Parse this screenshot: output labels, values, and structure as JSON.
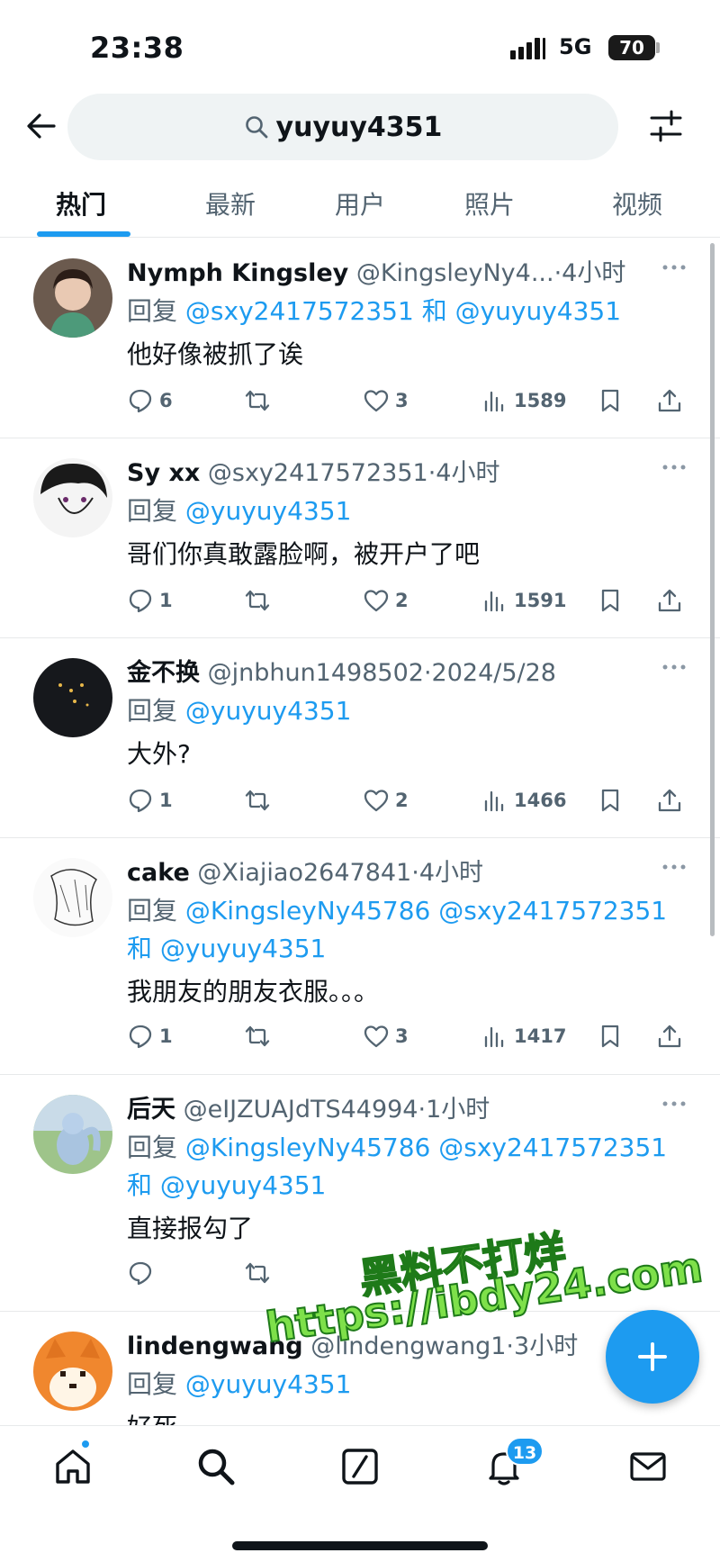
{
  "status_bar": {
    "time": "23:38",
    "network": "5G",
    "battery": "70"
  },
  "search": {
    "query": "yuyuy4351"
  },
  "tabs": [
    {
      "label": "热门",
      "active": true
    },
    {
      "label": "最新",
      "active": false
    },
    {
      "label": "用户",
      "active": false
    },
    {
      "label": "照片",
      "active": false
    },
    {
      "label": "视频",
      "active": false
    }
  ],
  "tweets": [
    {
      "name": "Nymph Kingsley",
      "handle": "@KingsleyNy4...",
      "dot": "·",
      "time": "4小时",
      "reply_prefix": "回复",
      "reply_line1": "@sxy2417572351 和 @yuyuy4351",
      "reply_line2": "",
      "text": "他好像被抓了诶",
      "replies": "6",
      "retweets": "",
      "likes": "3",
      "views": "1589"
    },
    {
      "name": "Sy xx",
      "handle": "@sxy2417572351",
      "dot": "·",
      "time": "4小时",
      "reply_prefix": "回复",
      "reply_line1": "@yuyuy4351",
      "reply_line2": "",
      "text": "哥们你真敢露脸啊，被开户了吧",
      "replies": "1",
      "retweets": "",
      "likes": "2",
      "views": "1591"
    },
    {
      "name": "金不换",
      "handle": "@jnbhun1498502",
      "dot": "·",
      "time": "2024/5/28",
      "reply_prefix": "回复",
      "reply_line1": "@yuyuy4351",
      "reply_line2": "",
      "text": "大外?",
      "replies": "1",
      "retweets": "",
      "likes": "2",
      "views": "1466"
    },
    {
      "name": "cake",
      "handle": "@Xiajiao2647841",
      "dot": "·",
      "time": "4小时",
      "reply_prefix": "回复",
      "reply_line1": "@KingsleyNy45786 @sxy2417572351",
      "reply_line2": "和 @yuyuy4351",
      "text": "我朋友的朋友衣服。。。",
      "replies": "1",
      "retweets": "",
      "likes": "3",
      "views": "1417"
    },
    {
      "name": "后天",
      "handle": "@eIJZUAJdTS44994",
      "dot": "·",
      "time": "1小时",
      "reply_prefix": "回复",
      "reply_line1": "@KingsleyNy45786 @sxy2417572351",
      "reply_line2": "和 @yuyuy4351",
      "text": "直接报勾了",
      "replies": "",
      "retweets": "",
      "likes": "",
      "views": ""
    },
    {
      "name": "lindengwang",
      "handle": "@lindengwang1",
      "dot": "·",
      "time": "3小时",
      "reply_prefix": "回复",
      "reply_line1": "@yuyuy4351",
      "reply_line2": "",
      "text": "好死",
      "replies": "",
      "retweets": "",
      "likes": "",
      "views": ""
    }
  ],
  "watermark": {
    "line1": "黑料不打烊",
    "line2": "https://ibdy24.com"
  },
  "bottom_nav": {
    "notifications_badge": "13"
  },
  "colors": {
    "accent": "#1d9bf0",
    "text": "#0f1419",
    "muted": "#536471",
    "watermark": "#7ee04a"
  },
  "icons": [
    "back-arrow-icon",
    "search-icon",
    "filter-icon",
    "more-icon",
    "reply-icon",
    "retweet-icon",
    "like-icon",
    "views-icon",
    "bookmark-icon",
    "share-icon",
    "compose-icon",
    "home-icon",
    "grok-icon",
    "bell-icon",
    "mail-icon"
  ]
}
